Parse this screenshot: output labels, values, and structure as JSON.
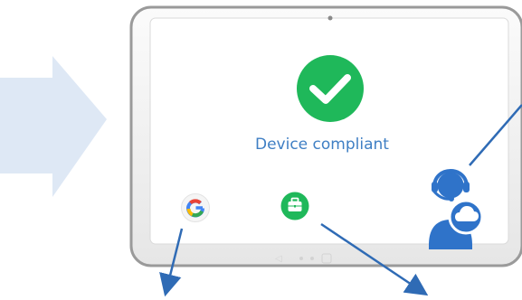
{
  "screen": {
    "status_text": "Device compliant"
  },
  "icons": {
    "arrow": "large-right-arrow-icon",
    "check": "check-circle-icon",
    "google": "google-g-icon",
    "work": "briefcase-icon",
    "support": "support-agent-cloud-icon"
  },
  "colors": {
    "arrow_fill": "#dce7f4",
    "tablet_bezel": "#f2f2f2",
    "tablet_border": "#9a9a9a",
    "success_green": "#1fb85a",
    "label_blue": "#3f7fc4",
    "support_blue": "#2f73c9",
    "pointer_line": "#2f6bb5"
  }
}
